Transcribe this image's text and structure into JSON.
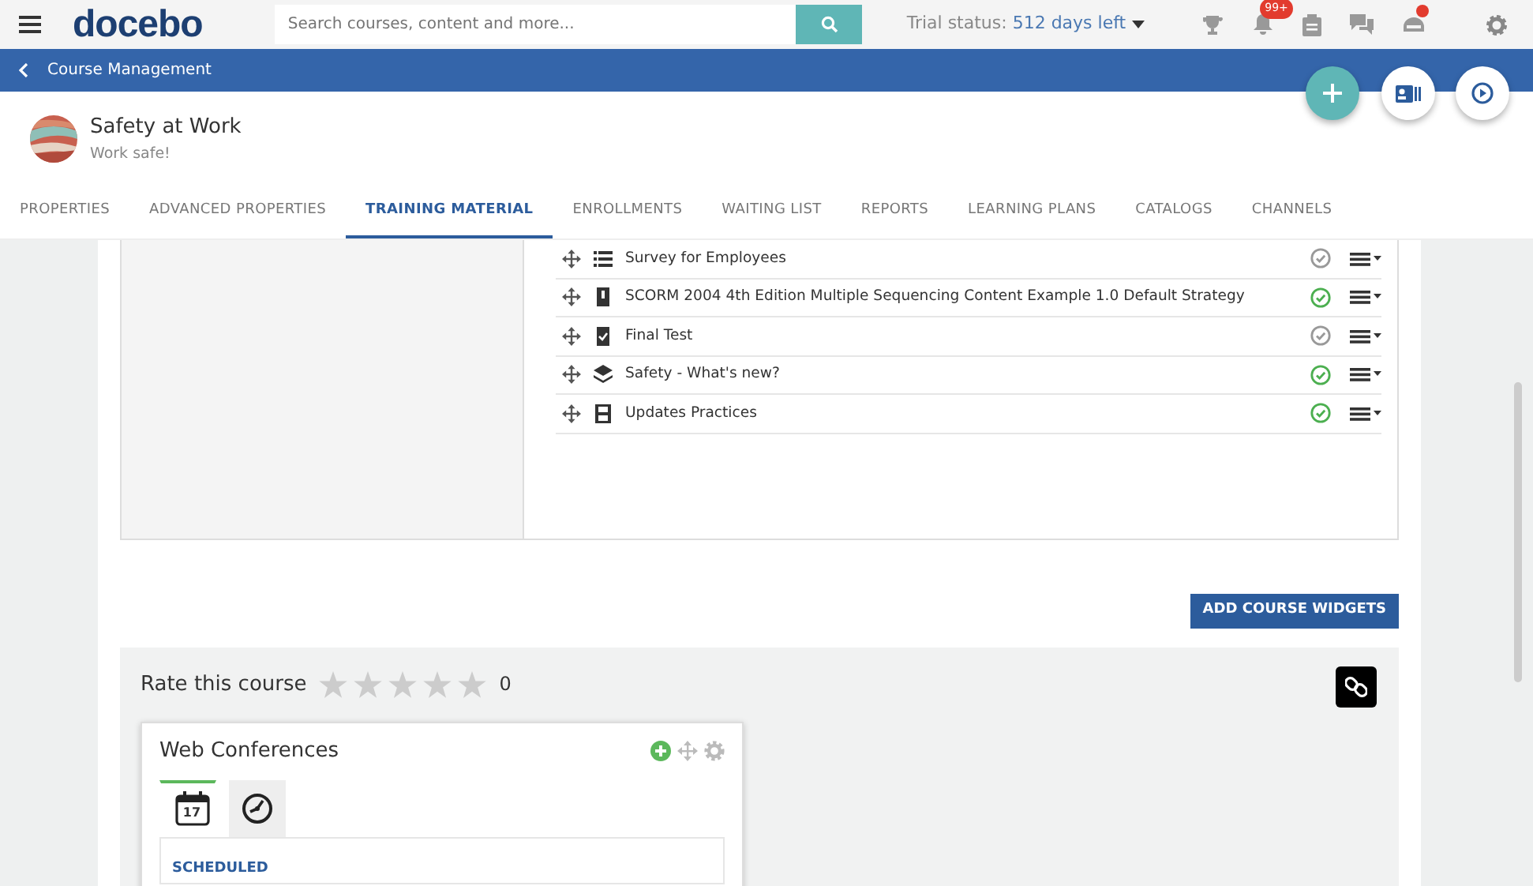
{
  "topbar": {
    "logo": "docebo",
    "search": {
      "placeholder": "Search courses, content and more..."
    },
    "trial": {
      "label": "Trial status:",
      "days": "512",
      "suffix": "days left"
    },
    "notifications_badge": "99+",
    "messages_dot": true
  },
  "breadcrumb": {
    "back": "Course Management"
  },
  "course": {
    "title": "Safety at Work",
    "subtitle": "Work safe!"
  },
  "tabs": [
    {
      "label": "PROPERTIES",
      "selected": false
    },
    {
      "label": "ADVANCED PROPERTIES",
      "selected": false
    },
    {
      "label": "TRAINING MATERIAL",
      "selected": true
    },
    {
      "label": "ENROLLMENTS",
      "selected": false
    },
    {
      "label": "WAITING LIST",
      "selected": false
    },
    {
      "label": "REPORTS",
      "selected": false
    },
    {
      "label": "LEARNING PLANS",
      "selected": false
    },
    {
      "label": "CATALOGS",
      "selected": false
    },
    {
      "label": "CHANNELS",
      "selected": false
    }
  ],
  "materials": [
    {
      "title": "Survey for Employees",
      "kind": "survey",
      "published": false
    },
    {
      "title": "SCORM 2004 4th Edition Multiple Sequencing Content Example 1.0 Default Strategy",
      "kind": "scorm",
      "published": true
    },
    {
      "title": "Final Test",
      "kind": "test",
      "published": false
    },
    {
      "title": "Safety - What's new?",
      "kind": "layers",
      "published": true
    },
    {
      "title": "Updates Practices",
      "kind": "video",
      "published": true
    }
  ],
  "add_widgets_button": "ADD COURSE WIDGETS",
  "rating": {
    "label": "Rate this course",
    "stars": 0,
    "count": "0"
  },
  "web_conferences": {
    "title": "Web Conferences",
    "tabs": [
      {
        "kind": "calendar",
        "day": "17",
        "selected": true
      },
      {
        "kind": "clock",
        "selected": false
      }
    ],
    "section": "SCHEDULED"
  }
}
